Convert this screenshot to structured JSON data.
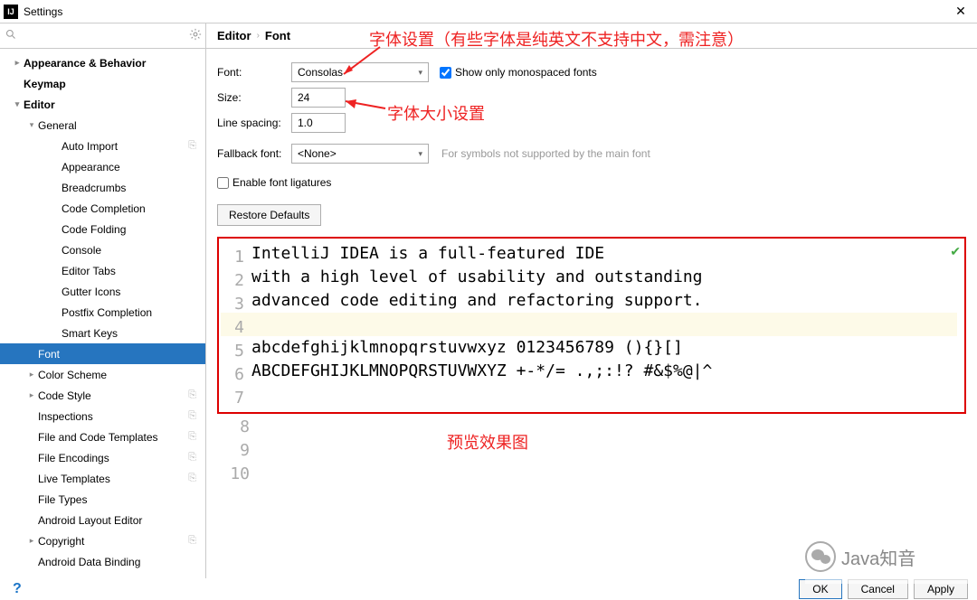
{
  "window": {
    "title": "Settings",
    "close": "✕"
  },
  "search": {
    "placeholder": ""
  },
  "sidebar": {
    "items": [
      {
        "label": "Appearance & Behavior",
        "lvl": 1,
        "exp": ">",
        "bold": true
      },
      {
        "label": "Keymap",
        "lvl": 1,
        "exp": "",
        "bold": true
      },
      {
        "label": "Editor",
        "lvl": 1,
        "exp": "v",
        "bold": true
      },
      {
        "label": "General",
        "lvl": 2,
        "exp": "v"
      },
      {
        "label": "Auto Import",
        "lvl": 3,
        "paste": true
      },
      {
        "label": "Appearance",
        "lvl": 3
      },
      {
        "label": "Breadcrumbs",
        "lvl": 3
      },
      {
        "label": "Code Completion",
        "lvl": 3
      },
      {
        "label": "Code Folding",
        "lvl": 3
      },
      {
        "label": "Console",
        "lvl": 3
      },
      {
        "label": "Editor Tabs",
        "lvl": 3
      },
      {
        "label": "Gutter Icons",
        "lvl": 3
      },
      {
        "label": "Postfix Completion",
        "lvl": 3
      },
      {
        "label": "Smart Keys",
        "lvl": 3
      },
      {
        "label": "Font",
        "lvl": 2,
        "selected": true
      },
      {
        "label": "Color Scheme",
        "lvl": 2,
        "exp": ">"
      },
      {
        "label": "Code Style",
        "lvl": 2,
        "exp": ">",
        "paste": true
      },
      {
        "label": "Inspections",
        "lvl": 2,
        "paste": true
      },
      {
        "label": "File and Code Templates",
        "lvl": 2,
        "paste": true
      },
      {
        "label": "File Encodings",
        "lvl": 2,
        "paste": true
      },
      {
        "label": "Live Templates",
        "lvl": 2,
        "paste": true
      },
      {
        "label": "File Types",
        "lvl": 2
      },
      {
        "label": "Android Layout Editor",
        "lvl": 2
      },
      {
        "label": "Copyright",
        "lvl": 2,
        "exp": ">",
        "paste": true
      },
      {
        "label": "Android Data Binding",
        "lvl": 2
      }
    ]
  },
  "breadcrumb": {
    "a": "Editor",
    "b": "Font"
  },
  "form": {
    "font_label": "Font:",
    "font_value": "Consolas",
    "mono_label": "Show only monospaced fonts",
    "size_label": "Size:",
    "size_value": "24",
    "spacing_label": "Line spacing:",
    "spacing_value": "1.0",
    "fallback_label": "Fallback font:",
    "fallback_value": "<None>",
    "fallback_hint": "For symbols not supported by the main font",
    "ligatures_label": "Enable font ligatures",
    "restore_label": "Restore Defaults"
  },
  "preview": {
    "lines": [
      "IntelliJ IDEA is a full-featured IDE",
      "with a high level of usability and outstanding",
      "advanced code editing and refactoring support.",
      "",
      "abcdefghijklmnopqrstuvwxyz 0123456789 (){}[]",
      "ABCDEFGHIJKLMNOPQRSTUVWXYZ +-*/= .,;:!? #&$%@|^"
    ],
    "nums_in": [
      "1",
      "2",
      "3",
      "4",
      "5",
      "6",
      "7"
    ],
    "nums_out": [
      "8",
      "9",
      "10"
    ]
  },
  "annotations": {
    "a1": "字体设置（有些字体是纯英文不支持中文，需注意）",
    "a2": "字体大小设置",
    "a3": "预览效果图"
  },
  "footer": {
    "ok": "OK",
    "cancel": "Cancel",
    "apply": "Apply"
  },
  "watermark": "Java知音"
}
